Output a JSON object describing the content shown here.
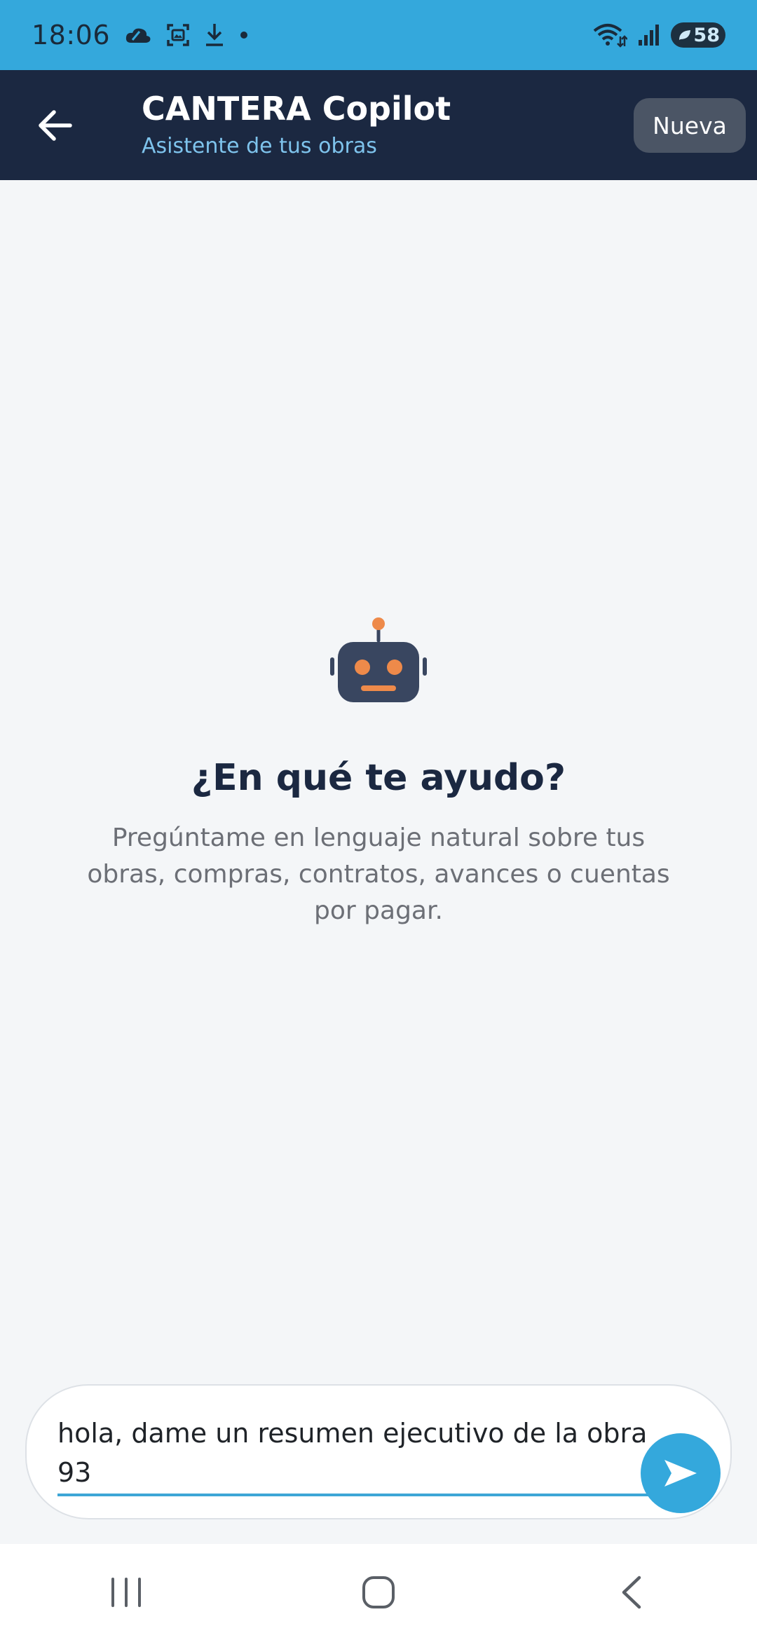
{
  "status_bar": {
    "time": "18:06",
    "battery_level": "58",
    "icons": [
      "weather-cloud-icon",
      "screenshot-icon",
      "download-icon",
      "dot-icon",
      "wifi-icon",
      "signal-icon",
      "battery-icon"
    ]
  },
  "header": {
    "title": "CANTERA Copilot",
    "subtitle": "Asistente de tus obras",
    "back_icon": "arrow-left-icon",
    "new_button_label": "Nueva"
  },
  "empty_state": {
    "icon": "robot-icon",
    "title": "¿En qué te ayudo?",
    "description": "Pregúntame en lenguaje natural sobre tus obras, compras, contratos, avances o cuentas por pagar."
  },
  "composer": {
    "value": "hola, dame un resumen ejecutivo de la obra 93",
    "send_icon": "send-icon"
  },
  "nav_bar": {
    "icons": [
      "recents-icon",
      "home-icon",
      "back-icon"
    ]
  },
  "colors": {
    "status_bar": "#34a8dc",
    "header": "#1b2841",
    "accent": "#34a8dc",
    "subtitle": "#7ec3ec",
    "robot_eye": "#ee8a4a"
  }
}
